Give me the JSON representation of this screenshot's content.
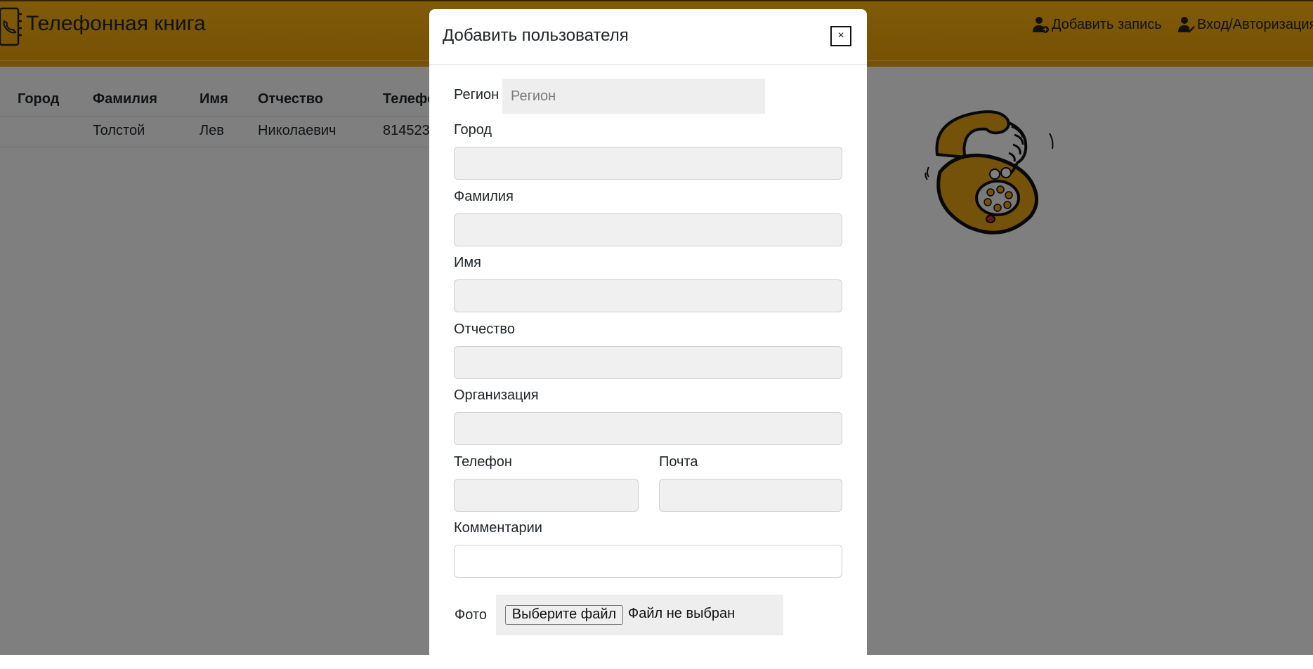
{
  "app": {
    "title": "Телефонная книга",
    "brand_icon": "phone-book-icon"
  },
  "nav": {
    "add_record": "Добавить запись",
    "add_record_icon": "user-plus-icon",
    "login": "Вход/Авторизация",
    "login_icon": "user-check-icon"
  },
  "table": {
    "headers": [
      "Город",
      "Фамилия",
      "Имя",
      "Отчество",
      "Телефо"
    ],
    "rows": [
      [
        "",
        "Толстой",
        "Лев",
        "Николаевич",
        "814523"
      ]
    ]
  },
  "modal": {
    "title": "Добавить пользователя",
    "close_label": "×",
    "fields": {
      "region": {
        "label": "Регион",
        "placeholder": "Регион",
        "value": ""
      },
      "city": {
        "label": "Город",
        "value": ""
      },
      "last_name": {
        "label": "Фамилия",
        "value": ""
      },
      "first_name": {
        "label": "Имя",
        "value": ""
      },
      "patronymic": {
        "label": "Отчество",
        "value": ""
      },
      "organization": {
        "label": "Организация",
        "value": ""
      },
      "phone": {
        "label": "Телефон",
        "value": ""
      },
      "email": {
        "label": "Почта",
        "value": ""
      },
      "comments": {
        "label": "Комментарии",
        "value": ""
      },
      "photo": {
        "label": "Фото",
        "button": "Выберите файл",
        "status": "Файл не выбран"
      }
    }
  },
  "colors": {
    "navbar": "#f5aa0c",
    "overlay": "rgba(0,0,0,0.5)",
    "field_bg": "#f0f0f0",
    "phone_art": "#eaa516"
  }
}
